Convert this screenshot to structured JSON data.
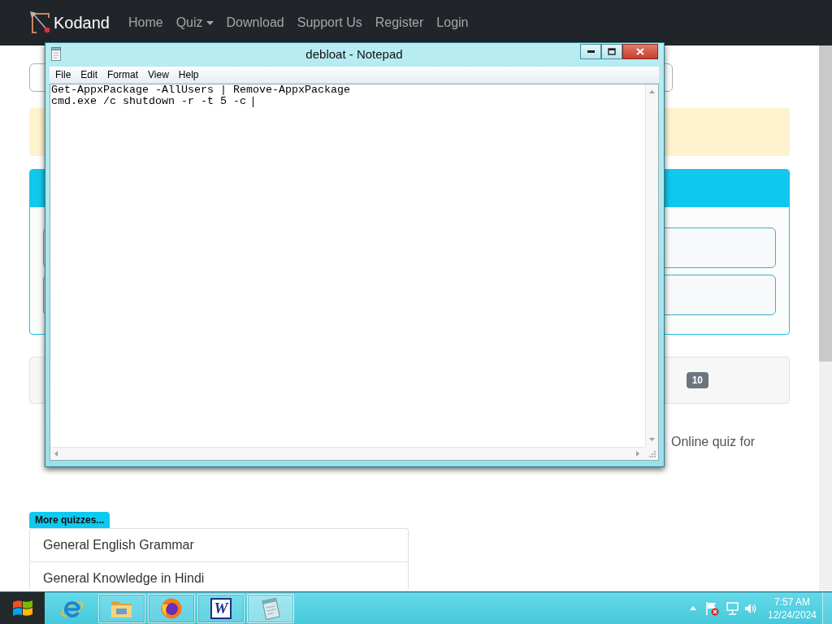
{
  "navbar": {
    "brand": "Kodand",
    "links": [
      {
        "label": "Home",
        "dropdown": false
      },
      {
        "label": "Quiz",
        "dropdown": true
      },
      {
        "label": "Download",
        "dropdown": false
      },
      {
        "label": "Support Us",
        "dropdown": false
      },
      {
        "label": "Register",
        "dropdown": false
      },
      {
        "label": "Login",
        "dropdown": false
      }
    ]
  },
  "page": {
    "count_badge": "10",
    "text_fragment": "Online quiz for",
    "more_quizzes": {
      "label": "More quizzes...",
      "items": [
        "General English Grammar",
        "General Knowledge in Hindi"
      ]
    }
  },
  "notepad": {
    "title": "debloat - Notepad",
    "menu": [
      "File",
      "Edit",
      "Format",
      "View",
      "Help"
    ],
    "lines": [
      "Get-AppxPackage -AllUsers | Remove-AppxPackage",
      "cmd.exe /c shutdown -r -t 5 -c"
    ]
  },
  "taskbar": {
    "apps": [
      {
        "kind": "browser_e",
        "running": false,
        "selected": false
      },
      {
        "kind": "folder",
        "running": true,
        "selected": false
      },
      {
        "kind": "globe",
        "running": true,
        "selected": false
      },
      {
        "kind": "word",
        "label": "W",
        "running": true,
        "selected": false
      },
      {
        "kind": "notepad",
        "running": true,
        "selected": true
      }
    ],
    "clock": {
      "time": "7:57 AM",
      "date": "12/24/2024"
    }
  }
}
